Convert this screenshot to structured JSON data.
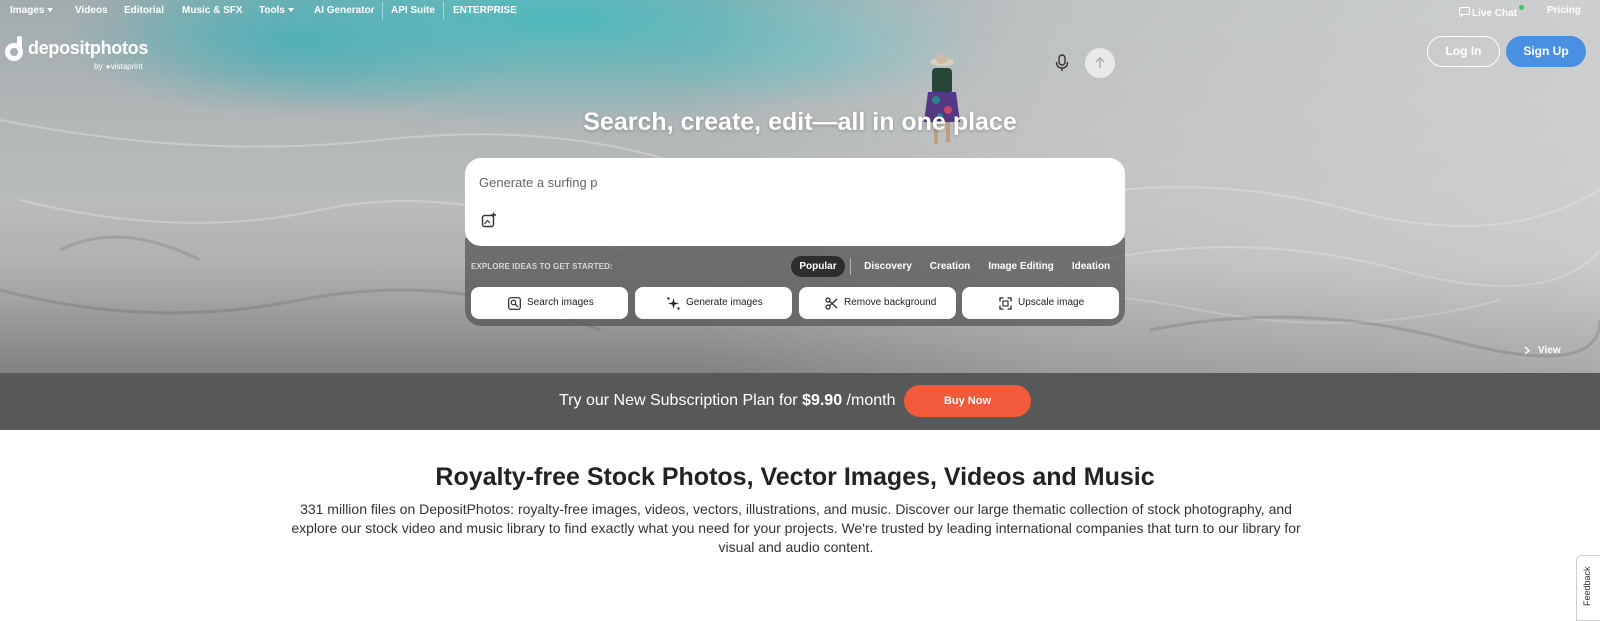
{
  "topnav": {
    "items": [
      "Images",
      "Videos",
      "Editorial",
      "Music & SFX",
      "Tools",
      "AI Generator",
      "API Suite",
      "ENTERPRISE"
    ],
    "right": {
      "live_chat": "Live Chat",
      "pricing": "Pricing"
    }
  },
  "logo": {
    "name": "depositphotos",
    "by": "by",
    "partner": "vistaprint"
  },
  "auth": {
    "login": "Log In",
    "signup": "Sign Up"
  },
  "hero": {
    "title": "Search, create, edit—all in one place",
    "search_placeholder": "Generate a surfing p",
    "ideas_label": "EXPLORE IDEAS TO GET STARTED:",
    "chips": [
      "Popular",
      "Discovery",
      "Creation",
      "Image Editing",
      "Ideation"
    ],
    "active_chip": "Popular",
    "actions": [
      {
        "label": "Search images",
        "icon": "search-images-icon"
      },
      {
        "label": "Generate images",
        "icon": "sparkle-icon"
      },
      {
        "label": "Remove background",
        "icon": "scissors-icon"
      },
      {
        "label": "Upscale image",
        "icon": "upscale-icon"
      }
    ],
    "view": "View"
  },
  "promo": {
    "text": "Try our New Subscription Plan for ",
    "price": "$9.90",
    "suffix": " /month",
    "button": "Buy Now"
  },
  "main": {
    "title": "Royalty-free Stock Photos, Vector Images, Videos and Music",
    "description": "331 million files on DepositPhotos: royalty-free images, videos, vectors, illustrations, and music. Discover our large thematic collection of stock photography, and explore our stock video and music library to find exactly what you need for your projects. We're trusted by leading international companies that turn to our library for visual and audio content."
  },
  "feedback": "Feedback",
  "colors": {
    "accent_blue": "#4a90e2",
    "buy_orange": "#f15a3a",
    "promo_bg": "#585858",
    "live_green": "#2ecc71"
  }
}
